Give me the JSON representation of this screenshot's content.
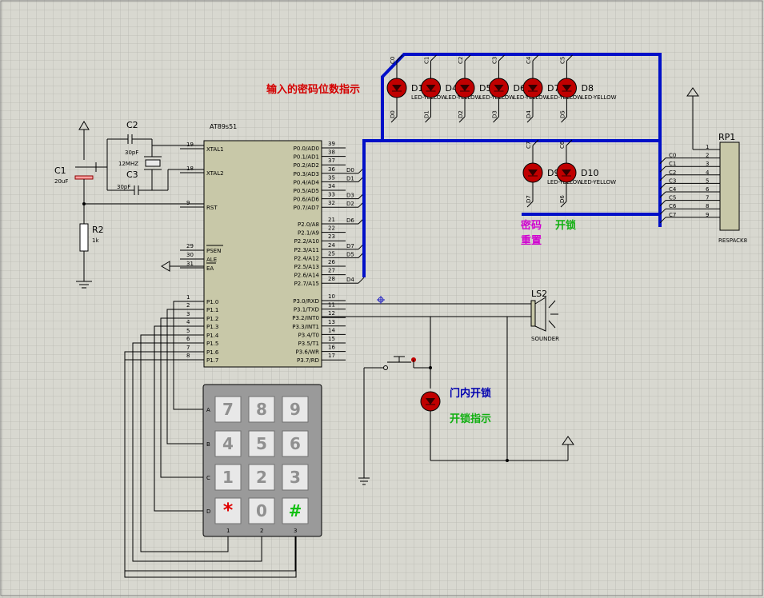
{
  "mcu": {
    "name": "AT89s51",
    "left_pins": [
      {
        "num": "19",
        "name": "XTAL1"
      },
      {
        "num": "18",
        "name": "XTAL2"
      },
      {
        "num": "9",
        "name": "RST"
      },
      {
        "num": "29",
        "name": "PSEN"
      },
      {
        "num": "30",
        "name": "ALE"
      },
      {
        "num": "31",
        "name": "EA"
      },
      {
        "num": "1",
        "name": "P1.0"
      },
      {
        "num": "2",
        "name": "P1.1"
      },
      {
        "num": "3",
        "name": "P1.2"
      },
      {
        "num": "4",
        "name": "P1.3"
      },
      {
        "num": "5",
        "name": "P1.4"
      },
      {
        "num": "6",
        "name": "P1.5"
      },
      {
        "num": "7",
        "name": "P1.6"
      },
      {
        "num": "8",
        "name": "P1.7"
      }
    ],
    "right_pins": [
      {
        "num": "39",
        "name": "P0.0/AD0"
      },
      {
        "num": "38",
        "name": "P0.1/AD1"
      },
      {
        "num": "37",
        "name": "P0.2/AD2"
      },
      {
        "num": "36",
        "name": "P0.3/AD3"
      },
      {
        "num": "35",
        "name": "P0.4/AD4"
      },
      {
        "num": "34",
        "name": "P0.5/AD5"
      },
      {
        "num": "33",
        "name": "P0.6/AD6"
      },
      {
        "num": "32",
        "name": "P0.7/AD7"
      },
      {
        "num": "21",
        "name": "P2.0/A8"
      },
      {
        "num": "22",
        "name": "P2.1/A9"
      },
      {
        "num": "23",
        "name": "P2.2/A10"
      },
      {
        "num": "24",
        "name": "P2.3/A11"
      },
      {
        "num": "25",
        "name": "P2.4/A12"
      },
      {
        "num": "26",
        "name": "P2.5/A13"
      },
      {
        "num": "27",
        "name": "P2.6/A14"
      },
      {
        "num": "28",
        "name": "P2.7/A15"
      },
      {
        "num": "10",
        "name": "P3.0/RXD"
      },
      {
        "num": "11",
        "name": "P3.1/TXD"
      },
      {
        "num": "12",
        "name": "P3.2/INT0"
      },
      {
        "num": "13",
        "name": "P3.3/INT1"
      },
      {
        "num": "14",
        "name": "P3.4/T0"
      },
      {
        "num": "15",
        "name": "P3.5/T1"
      },
      {
        "num": "16",
        "name": "P3.6/WR"
      },
      {
        "num": "17",
        "name": "P3.7/RD"
      }
    ],
    "net_labels": [
      {
        "pin": "36",
        "label": "D0"
      },
      {
        "pin": "35",
        "label": "D1"
      },
      {
        "pin": "33",
        "label": "D3"
      },
      {
        "pin": "32",
        "label": "D2"
      },
      {
        "pin": "21",
        "label": "D6"
      },
      {
        "pin": "24",
        "label": "D7"
      },
      {
        "pin": "25",
        "label": "D5"
      },
      {
        "pin": "28",
        "label": "D4"
      }
    ]
  },
  "components": {
    "c1": {
      "ref": "C1",
      "value": "20uF"
    },
    "c2": {
      "ref": "C2",
      "value": "30pF"
    },
    "c3": {
      "ref": "C3",
      "value": "30pF"
    },
    "xtal": {
      "value": "12MHZ"
    },
    "r2": {
      "ref": "R2",
      "value": "1k"
    },
    "ls2": {
      "ref": "LS2",
      "value": "SOUNDER"
    },
    "rp1": {
      "ref": "RP1",
      "value": "RESPACK8",
      "pins": [
        "1",
        "2",
        "3",
        "4",
        "5",
        "6",
        "7",
        "8",
        "9"
      ],
      "nets": [
        "C0",
        "C1",
        "C2",
        "C3",
        "C4",
        "C5",
        "C6",
        "C7"
      ]
    }
  },
  "leds_top": [
    {
      "ref": "D1",
      "top": "C0",
      "bottom": "D0"
    },
    {
      "ref": "D4",
      "top": "C1",
      "bottom": "D1"
    },
    {
      "ref": "D5",
      "top": "C2",
      "bottom": "D2"
    },
    {
      "ref": "D6",
      "top": "C3",
      "bottom": "D3"
    },
    {
      "ref": "D7",
      "top": "C4",
      "bottom": "D4"
    },
    {
      "ref": "D8",
      "top": "C5",
      "bottom": "D5"
    }
  ],
  "led_type": "LED-YELLOW",
  "leds_bottom": [
    {
      "ref": "D9",
      "top": "C7",
      "bottom": "D7"
    },
    {
      "ref": "D10",
      "top": "C6",
      "bottom": "D6"
    }
  ],
  "keypad": {
    "rows": [
      "A",
      "B",
      "C",
      "D"
    ],
    "cols": [
      "1",
      "2",
      "3"
    ],
    "keys": [
      [
        "7",
        "8",
        "9"
      ],
      [
        "4",
        "5",
        "6"
      ],
      [
        "1",
        "2",
        "3"
      ],
      [
        "*",
        "0",
        "#"
      ]
    ]
  },
  "annotations": {
    "password_digits": "输入的密码位数指示",
    "pwd_reset_1": "密码",
    "pwd_reset_2": "重置",
    "unlock": "开锁",
    "door_unlock": "门内开锁",
    "unlock_indicator": "开锁指示"
  },
  "colors": {
    "bus": "#0010c8",
    "chip": "#c8c8a8",
    "keypad": "#9a9a9a",
    "led": "#c00000",
    "grid": "#b8b8b0"
  }
}
